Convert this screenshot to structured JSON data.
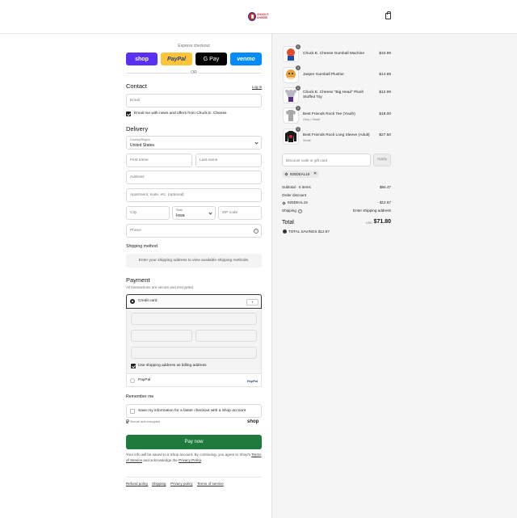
{
  "header": {
    "logo_text": "CHUCK E CHEESE",
    "cart_icon": "bag-icon"
  },
  "express": {
    "label": "Express checkout",
    "buttons": {
      "shop": "shop",
      "paypal": "PayPal",
      "gpay": "G Pay",
      "venmo": "venmo"
    },
    "or": "OR"
  },
  "contact": {
    "title": "Contact",
    "login": "Log in",
    "email_placeholder": "Email",
    "newsletter": "Email me with news and offers from Chuck E. Cheese",
    "newsletter_checked": true
  },
  "delivery": {
    "title": "Delivery",
    "country_label": "Country/Region",
    "country_value": "United States",
    "first_name": "First name",
    "last_name": "Last name",
    "address": "Address",
    "apartment": "Apartment, suite, etc. (optional)",
    "city": "City",
    "state_label": "State",
    "state_value": "Iowa",
    "zip": "ZIP code",
    "phone": "Phone"
  },
  "shipping": {
    "title": "Shipping method",
    "message": "Enter your shipping address to view available shipping methods."
  },
  "payment": {
    "title": "Payment",
    "subtitle": "All transactions are secure and encrypted.",
    "credit_card": "Credit card",
    "billing_same": "Use shipping address as billing address",
    "paypal": "PayPal",
    "paypal_logo": "PayPal"
  },
  "remember": {
    "title": "Remember me",
    "save_info": "Save my information for a faster checkout with a Shop account",
    "secure": "Secure and encrypted",
    "shop_brand": "shop"
  },
  "pay_now": "Pay now",
  "legal": {
    "text1": "Your info will be saved to a Shop account. By continuing, you agree to Shop's",
    "terms": "Terms of Service",
    "text2": "and acknowledge the",
    "privacy": "Privacy Policy",
    "text3": "."
  },
  "footer": {
    "links": [
      "Refund policy",
      "Shipping",
      "Privacy policy",
      "Terms of service"
    ]
  },
  "order": {
    "items": [
      {
        "qty": "1",
        "name": "Chuck E. Cheese Gumball Machine",
        "variant": "",
        "price": "$10.99"
      },
      {
        "qty": "1",
        "name": "Jasper Gumball Plushie",
        "variant": "",
        "price": "$14.99"
      },
      {
        "qty": "1",
        "name": "Chuck E. Cheese \"Big Head\" Plush Stuffed Toy",
        "variant": "",
        "price": "$12.99"
      },
      {
        "qty": "1",
        "name": "Best Friends Rock Tee (Youth)",
        "variant": "Grey / Small",
        "price": "$18.00"
      },
      {
        "qty": "1",
        "name": "Best Friends Rock Long Sleeve (Adult)",
        "variant": "Small",
        "price": "$27.50"
      }
    ],
    "discount_placeholder": "Discount code or gift card",
    "apply": "Apply",
    "applied_code": "925DEAL15",
    "subtotal_label": "Subtotal · 5 items",
    "subtotal_value": "$84.47",
    "order_discount_label": "Order discount",
    "discount_code": "925DEAL15",
    "discount_value": "- $12.67",
    "shipping_label": "Shipping",
    "shipping_value": "Enter shipping address",
    "total_label": "Total",
    "currency": "USD",
    "total_value": "$71.80",
    "savings": "TOTAL SAVINGS $12.67"
  }
}
